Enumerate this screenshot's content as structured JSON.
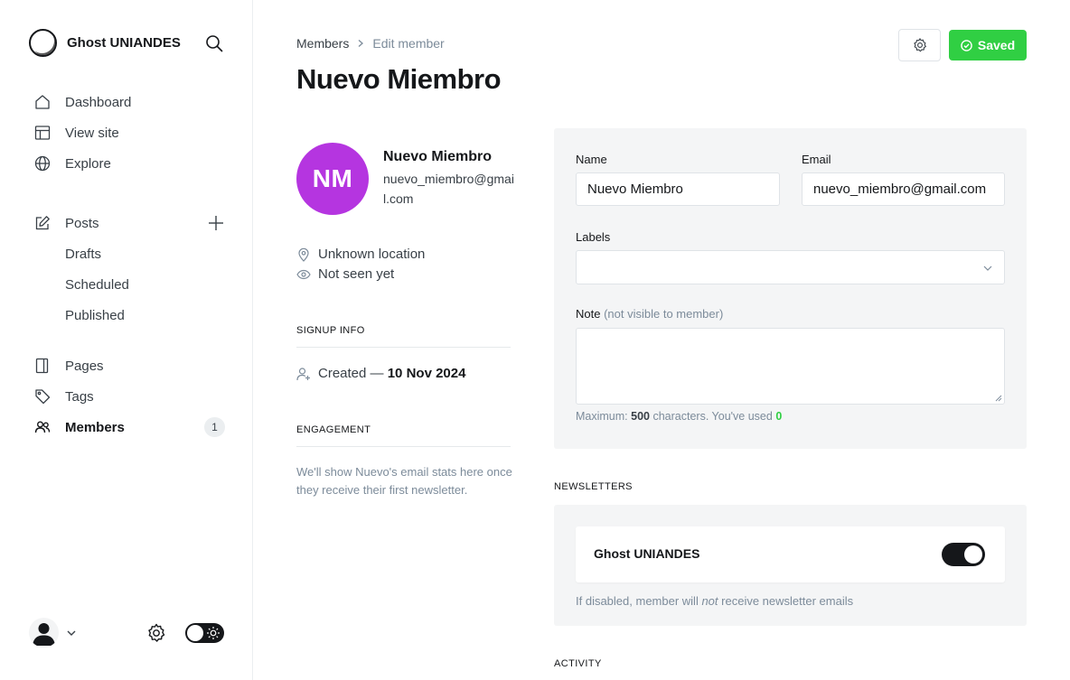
{
  "sidebar": {
    "brand": "Ghost UNIANDES",
    "nav": {
      "dashboard": "Dashboard",
      "view_site": "View site",
      "explore": "Explore",
      "posts": "Posts",
      "drafts": "Drafts",
      "scheduled": "Scheduled",
      "published": "Published",
      "pages": "Pages",
      "tags": "Tags",
      "members": "Members",
      "members_count": "1"
    }
  },
  "header": {
    "breadcrumb_parent": "Members",
    "breadcrumb_current": "Edit member",
    "title": "Nuevo Miembro",
    "saved_label": "Saved"
  },
  "member": {
    "initials": "NM",
    "name": "Nuevo Miembro",
    "email": "nuevo_miembro@gmail.com",
    "location": "Unknown location",
    "seen": "Not seen yet",
    "signup_info_heading": "SIGNUP INFO",
    "created_label": "Created —",
    "created_date": "10 Nov 2024",
    "engagement_heading": "ENGAGEMENT",
    "engagement_text": "We'll show Nuevo's email stats here once they receive their first newsletter."
  },
  "form": {
    "name_label": "Name",
    "name_value": "Nuevo Miembro",
    "email_label": "Email",
    "email_value": "nuevo_miembro@gmail.com",
    "labels_label": "Labels",
    "note_label": "Note",
    "note_sublabel": "(not visible to member)",
    "hint_prefix": "Maximum:",
    "hint_max": "500",
    "hint_middle": "characters. You've used",
    "hint_used": "0"
  },
  "newsletters": {
    "heading": "NEWSLETTERS",
    "name": "Ghost UNIANDES",
    "enabled": true,
    "hint_prefix": "If disabled, member will",
    "hint_not": "not",
    "hint_suffix": "receive newsletter emails"
  },
  "activity_heading": "ACTIVITY",
  "colors": {
    "accent_green": "#30cf43",
    "avatar_purple": "#b535e0"
  }
}
